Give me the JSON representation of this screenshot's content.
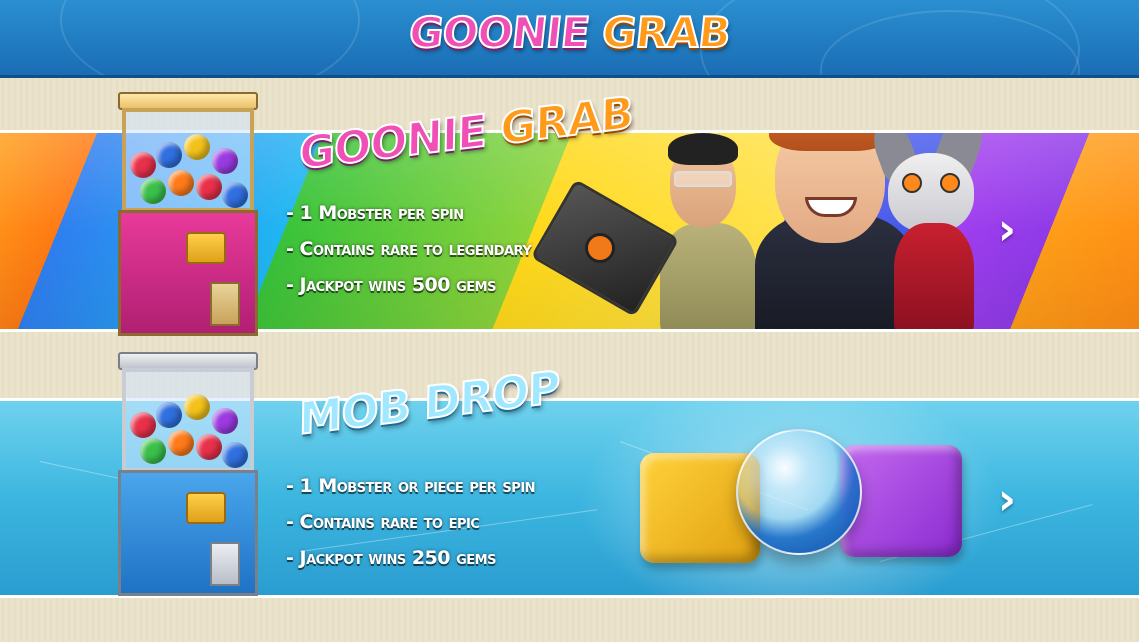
{
  "header": {
    "title_part1": "GOONIE",
    "title_part2": "GRAB"
  },
  "offers": [
    {
      "title_part1": "GOONIE",
      "title_part2": "GRAB",
      "features": [
        "- 1 Mobster per spin",
        "- Contains rare to legendary",
        "- Jackpot wins 500 gems"
      ],
      "chevron": "›"
    },
    {
      "title": "MOB DROP",
      "features": [
        "- 1 Mobster or piece per spin",
        "- Contains rare to epic",
        "- Jackpot wins 250 gems"
      ],
      "chevron": "›"
    }
  ],
  "colors": {
    "header_blue": "#1a6db5",
    "title_pink": "#f04fb5",
    "title_orange": "#ff9a1a",
    "mob_drop_blue": "#9fe8ff"
  }
}
